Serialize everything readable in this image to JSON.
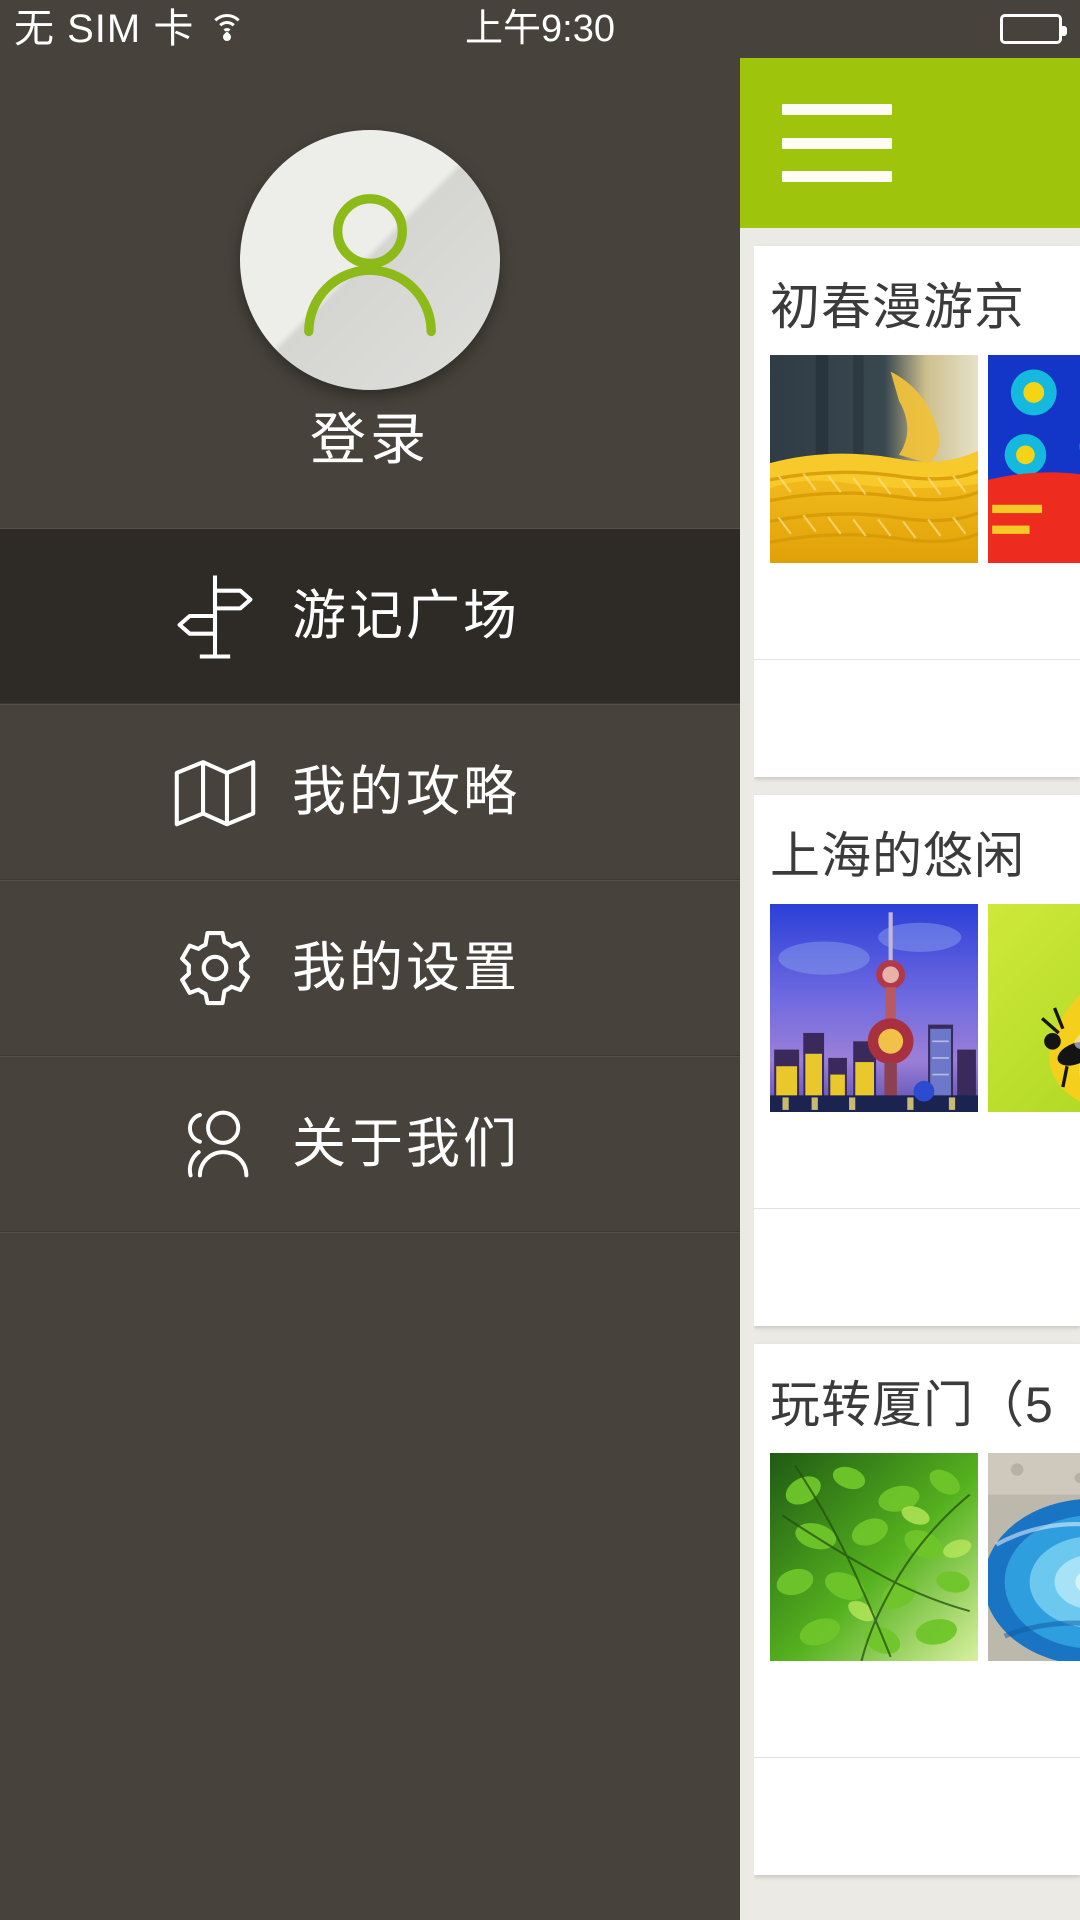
{
  "status_bar": {
    "carrier": "无 SIM 卡",
    "wifi_icon": "wifi-icon",
    "time": "上午9:30",
    "battery_icon": "battery-full-icon"
  },
  "drawer": {
    "profile": {
      "avatar_icon": "user-avatar-icon",
      "login_label": "登录"
    },
    "menu": [
      {
        "label": "游记广场",
        "icon": "signpost-icon",
        "active": true
      },
      {
        "label": "我的攻略",
        "icon": "map-fold-icon",
        "active": false
      },
      {
        "label": "我的设置",
        "icon": "gear-icon",
        "active": false
      },
      {
        "label": "关于我们",
        "icon": "people-icon",
        "active": false
      }
    ]
  },
  "content_panel": {
    "header": {
      "menu_icon": "hamburger-icon",
      "accent_color": "#9ec40c"
    },
    "cards": [
      {
        "title": "初春漫游京",
        "photos": [
          "yellow-rope-on-wood-photo",
          "blue-red-colorful-photo"
        ]
      },
      {
        "title": "上海的悠闲",
        "photos": [
          "shanghai-skyline-night-photo",
          "yellow-flower-bee-photo"
        ]
      },
      {
        "title": "玩转厦门（5",
        "photos": [
          "green-leaves-photo",
          "blue-swirl-photo"
        ]
      }
    ]
  },
  "colors": {
    "drawer_bg": "#47423b",
    "drawer_active": "#2e2b27",
    "accent_green": "#9ec40c",
    "panel_bg": "#eceae4",
    "text_white": "#ffffff",
    "title_dark": "#3b3b3b"
  }
}
